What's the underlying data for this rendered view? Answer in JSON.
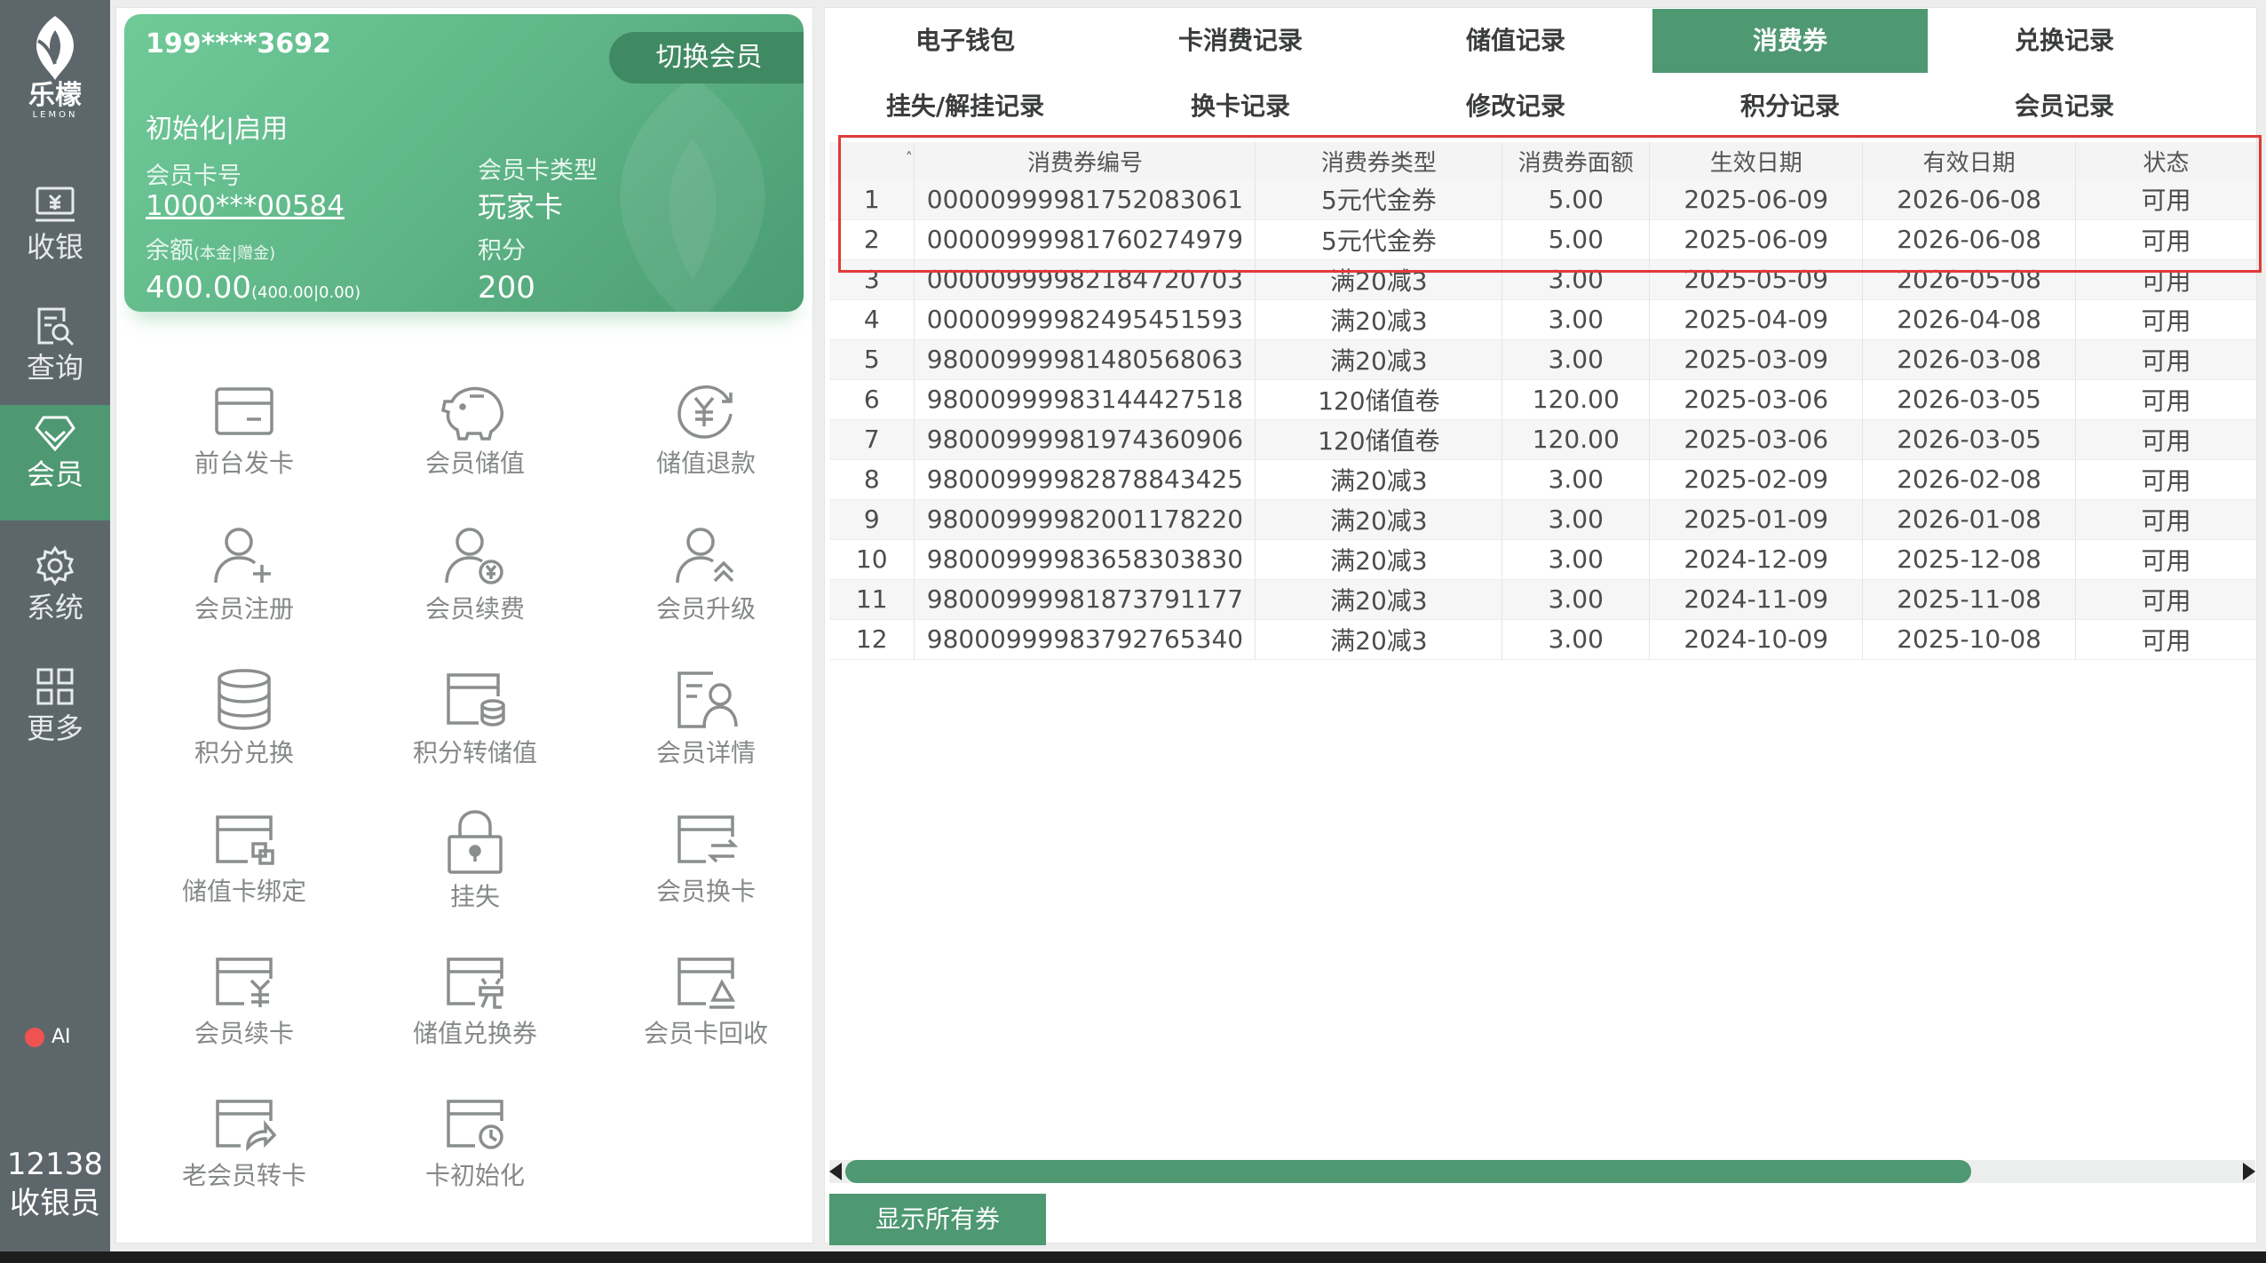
{
  "app": {
    "logo_text": "乐檬",
    "logo_sub": "LEMON"
  },
  "nav": {
    "items": [
      {
        "label": "收银"
      },
      {
        "label": "查询"
      },
      {
        "label": "会员"
      },
      {
        "label": "系统"
      },
      {
        "label": "更多"
      }
    ],
    "ai_label": "AI",
    "user_id": "12138",
    "user_role": "收银员"
  },
  "member_card": {
    "phone": "199****3692",
    "switch_label": "切换会员",
    "status": "初始化|启用",
    "card_no_label": "会员卡号",
    "card_no": "1000***00584",
    "card_type_label": "会员卡类型",
    "card_type": "玩家卡",
    "balance_label": "余额",
    "balance_sub_label": "(本金|赠金)",
    "balance": "400.00",
    "balance_detail": "(400.00|0.00)",
    "points_label": "积分",
    "points": "200"
  },
  "functions": [
    {
      "label": "前台发卡",
      "icon": "card-icon"
    },
    {
      "label": "会员储值",
      "icon": "piggy-bank-icon"
    },
    {
      "label": "储值退款",
      "icon": "yen-refund-icon"
    },
    {
      "label": "会员注册",
      "icon": "user-add-icon"
    },
    {
      "label": "会员续费",
      "icon": "user-yen-icon"
    },
    {
      "label": "会员升级",
      "icon": "user-upgrade-icon"
    },
    {
      "label": "积分兑换",
      "icon": "database-icon"
    },
    {
      "label": "积分转储值",
      "icon": "wallet-transfer-icon"
    },
    {
      "label": "会员详情",
      "icon": "user-detail-icon"
    },
    {
      "label": "储值卡绑定",
      "icon": "card-bind-icon"
    },
    {
      "label": "挂失",
      "icon": "lock-icon"
    },
    {
      "label": "会员换卡",
      "icon": "card-swap-icon"
    },
    {
      "label": "会员续卡",
      "icon": "card-yen-icon"
    },
    {
      "label": "储值兑换券",
      "icon": "card-exchange-icon"
    },
    {
      "label": "会员卡回收",
      "icon": "card-recycle-icon"
    },
    {
      "label": "老会员转卡",
      "icon": "card-share-icon"
    },
    {
      "label": "卡初始化",
      "icon": "card-reset-icon"
    }
  ],
  "tabs": {
    "row1": [
      "电子钱包",
      "卡消费记录",
      "储值记录",
      "消费券",
      "兑换记录"
    ],
    "row2": [
      "挂失/解挂记录",
      "换卡记录",
      "修改记录",
      "积分记录",
      "会员记录"
    ],
    "active": "消费券"
  },
  "table": {
    "headers": [
      "",
      "消费券编号",
      "消费券类型",
      "消费券面额",
      "生效日期",
      "有效日期",
      "状态"
    ],
    "rows": [
      [
        "1",
        "00000999981752083061",
        "5元代金券",
        "5.00",
        "2025-06-09",
        "2026-06-08",
        "可用"
      ],
      [
        "2",
        "00000999981760274979",
        "5元代金券",
        "5.00",
        "2025-06-09",
        "2026-06-08",
        "可用"
      ],
      [
        "3",
        "00000999982184720703",
        "满20减3",
        "3.00",
        "2025-05-09",
        "2026-05-08",
        "可用"
      ],
      [
        "4",
        "00000999982495451593",
        "满20减3",
        "3.00",
        "2025-04-09",
        "2026-04-08",
        "可用"
      ],
      [
        "5",
        "98000999981480568063",
        "满20减3",
        "3.00",
        "2025-03-09",
        "2026-03-08",
        "可用"
      ],
      [
        "6",
        "98000999983144427518",
        "120储值卷",
        "120.00",
        "2025-03-06",
        "2026-03-05",
        "可用"
      ],
      [
        "7",
        "98000999981974360906",
        "120储值卷",
        "120.00",
        "2025-03-06",
        "2026-03-05",
        "可用"
      ],
      [
        "8",
        "98000999982878843425",
        "满20减3",
        "3.00",
        "2025-02-09",
        "2026-02-08",
        "可用"
      ],
      [
        "9",
        "98000999982001178220",
        "满20减3",
        "3.00",
        "2025-01-09",
        "2026-01-08",
        "可用"
      ],
      [
        "10",
        "98000999983658303830",
        "满20减3",
        "3.00",
        "2024-12-09",
        "2025-12-08",
        "可用"
      ],
      [
        "11",
        "98000999981873791177",
        "满20减3",
        "3.00",
        "2024-11-09",
        "2025-11-08",
        "可用"
      ],
      [
        "12",
        "98000999983792765340",
        "满20减3",
        "3.00",
        "2024-10-09",
        "2025-10-08",
        "可用"
      ]
    ]
  },
  "show_all_label": "显示所有券",
  "colors": {
    "accent": "#4e9872",
    "nav_bg": "#5d676b",
    "highlight": "#e03a3a"
  }
}
